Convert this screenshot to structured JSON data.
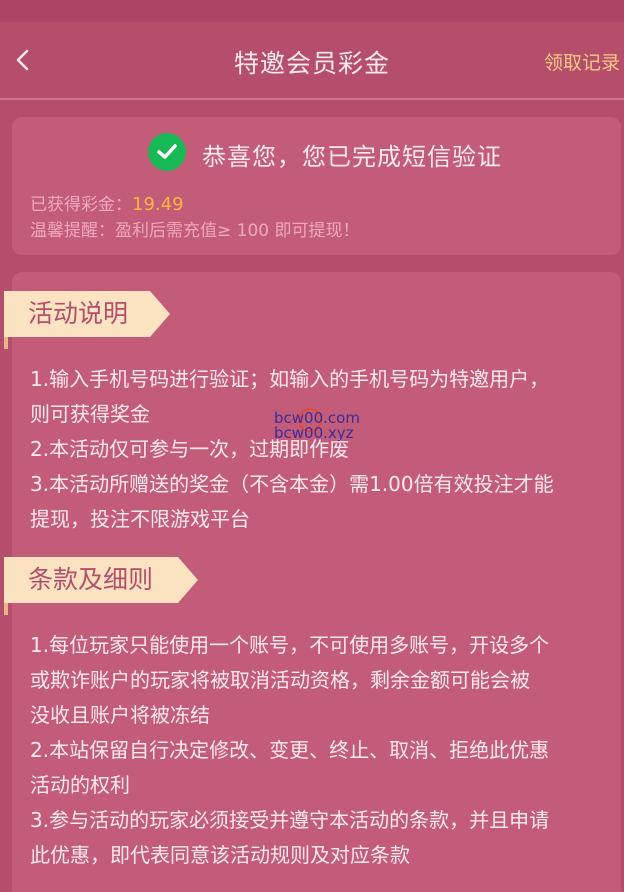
{
  "nav": {
    "title": "特邀会员彩金",
    "record_link": "领取记录"
  },
  "status": {
    "message": "恭喜您，您已完成短信验证",
    "earned_label": "已获得彩金：",
    "earned_amount": "19.49",
    "tip": "温馨提醒：盈利后需充值≥ 100 即可提现！"
  },
  "activity": {
    "heading": "活动说明",
    "lines": [
      "1.输入手机号码进行验证；如输入的手机号码为特邀用户，",
      "则可获得奖金",
      "2.本活动仅可参与一次，过期即作废",
      "3.本活动所赠送的奖金（不含本金）需1.00倍有效投注才能",
      "提现，投注不限游戏平台"
    ]
  },
  "terms": {
    "heading": "条款及细则",
    "lines": [
      "1.每位玩家只能使用一个账号，不可使用多账号，开设多个",
      "或欺诈账户的玩家将被取消活动资格，剩余金额可能会被",
      "没收且账户将被冻结",
      "2.本站保留自行决定修改、变更、终止、取消、拒绝此优惠",
      "活动的权利",
      "3.参与活动的玩家必须接受并遵守本活动的条款，并且申请",
      "此优惠，即代表同意该活动规则及对应条款"
    ]
  },
  "watermark": {
    "line1": "bcw00.com",
    "line2": "bcw00.xyz"
  },
  "colors": {
    "background": "#b54e6b",
    "card": "#c35c79",
    "accent_gold": "#f6c981",
    "amount": "#ffb43c",
    "success_green": "#18b954",
    "ribbon": "#fbe2c1"
  },
  "icons": {
    "back": "chevron-left-icon",
    "success": "check-circle-icon"
  }
}
